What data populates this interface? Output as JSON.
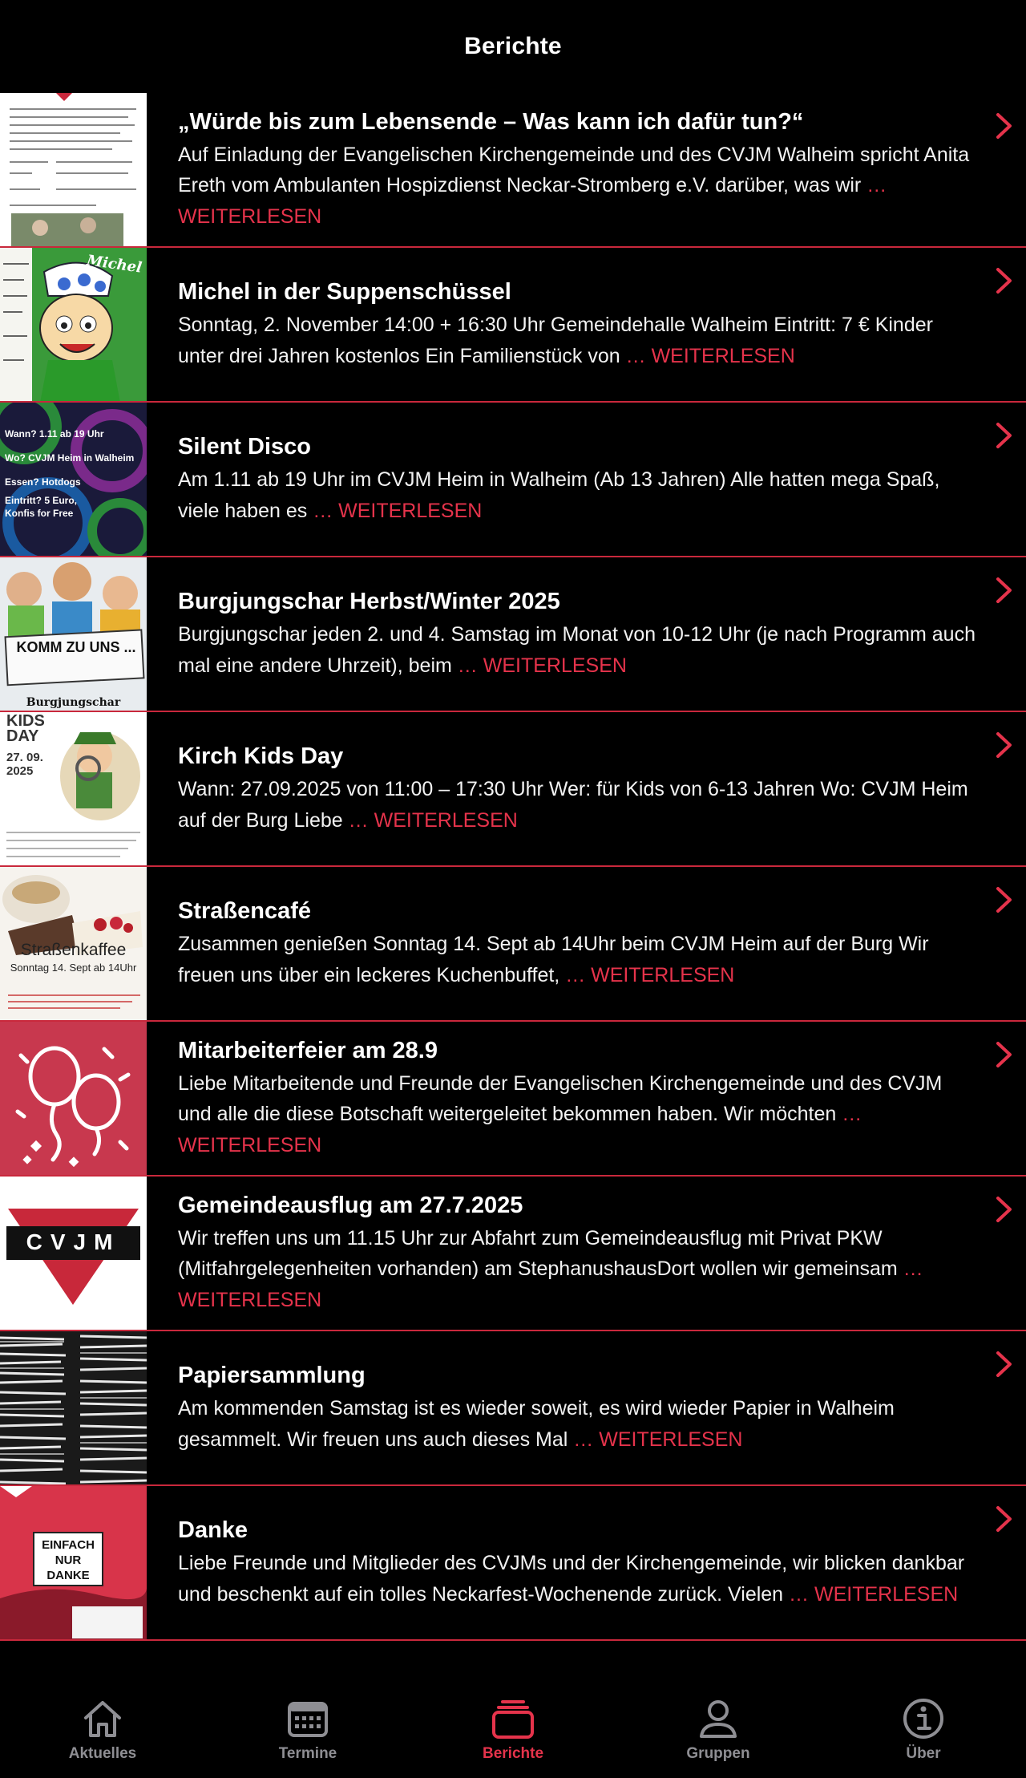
{
  "header": {
    "title": "Berichte"
  },
  "colors": {
    "accent": "#e5334b",
    "divider": "#c9283c",
    "background": "#000000",
    "inactive_tab": "#8e8e93"
  },
  "more_label": "… WEITERLESEN",
  "articles": [
    {
      "title": "„Würde bis zum Lebensende – Was kann ich dafür tun?“",
      "teaser": "Auf Einladung der Evangelischen Kirchengemeinde und des CVJM Walheim spricht Anita Ereth vom Ambulanten Hospizdienst Neckar-Stromberg e.V. darüber, was wir"
    },
    {
      "title": "Michel in der Suppenschüssel",
      "teaser": "Sonntag, 2. November 14:00 + 16:30 Uhr Gemeindehalle Walheim Eintritt: 7 € Kinder unter drei Jahren kostenlos Ein Familienstück von"
    },
    {
      "title": "Silent Disco",
      "teaser": "Am 1.11 ab 19 Uhr im CVJM Heim in Walheim (Ab 13 Jahren) Alle hatten mega Spaß, viele haben es"
    },
    {
      "title": "Burgjungschar Herbst/Winter 2025",
      "teaser": "Burgjungschar jeden 2. und 4. Samstag im Monat von 10-12 Uhr (je nach Programm auch mal eine andere Uhrzeit), beim"
    },
    {
      "title": "Kirch Kids Day",
      "teaser": "Wann: 27.09.2025 von 11:00 – 17:30 Uhr Wer: für Kids von 6-13 Jahren Wo: CVJM Heim auf der Burg Liebe"
    },
    {
      "title": "Straßencafé",
      "teaser": "Zusammen genießen Sonntag 14. Sept ab 14Uhr beim CVJM Heim auf der Burg Wir freuen uns über ein leckeres Kuchenbuffet,"
    },
    {
      "title": "Mitarbeiterfeier am 28.9",
      "teaser": "Liebe Mitarbeitende und Freunde der Evangelischen Kirchengemeinde und des CVJM und alle die diese Botschaft weitergeleitet bekommen haben. Wir möchten"
    },
    {
      "title": "Gemeindeausflug am 27.7.2025",
      "teaser": "Wir treffen uns um 11.15 Uhr zur Abfahrt zum Gemeindeausflug mit Privat PKW (Mitfahrgelegenheiten vorhanden) am StephanushausDort wollen wir gemeinsam"
    },
    {
      "title": "Papiersammlung",
      "teaser": "Am kommenden Samstag ist es wieder soweit, es wird wieder Papier in Walheim gesammelt. Wir freuen uns auch dieses Mal"
    },
    {
      "title": "Danke",
      "teaser": "Liebe Freunde und Mitglieder des CVJMs und der Kirchengemeinde, wir blicken dankbar und beschenkt auf ein tolles Neckarfest-Wochenende zurück. Vielen"
    }
  ],
  "thumb_text": {
    "michel": "Michel",
    "disco_lines": [
      "Wann? 1.11 ab 19 Uhr",
      "Wo? CVJM Heim in Walheim",
      "Essen? Hotdogs",
      "Eintritt? 5 Euro, Konfis for Free"
    ],
    "burg_sign": "KOMM ZU UNS ...",
    "burg_name": "Burgjungschar",
    "kids_title": "KIDS DAY",
    "kids_date": "27. 09. 2025",
    "cafe_title": "Straßenkaffee",
    "cafe_date": "Sonntag 14. Sept ab 14Uhr",
    "cvjm_logo": "CVJM",
    "danke_sign": "EINFACH NUR DANKE"
  },
  "tabs": [
    {
      "label": "Aktuelles",
      "icon": "house-icon",
      "active": false
    },
    {
      "label": "Termine",
      "icon": "calendar-icon",
      "active": false
    },
    {
      "label": "Berichte",
      "icon": "stack-icon",
      "active": true
    },
    {
      "label": "Gruppen",
      "icon": "person-icon",
      "active": false
    },
    {
      "label": "Über",
      "icon": "info-icon",
      "active": false
    }
  ]
}
